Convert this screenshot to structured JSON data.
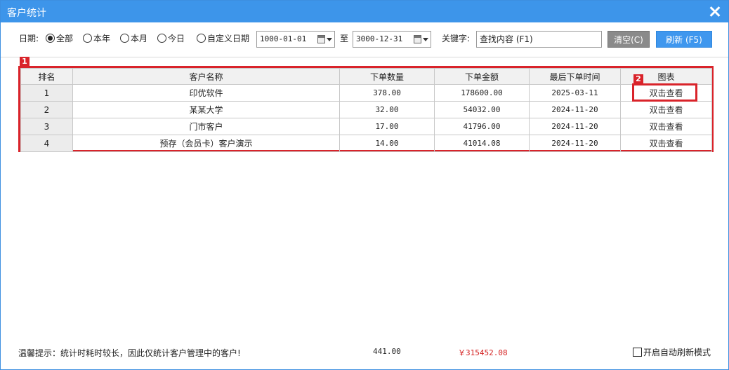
{
  "window": {
    "title": "客户统计",
    "close_icon": "close-icon"
  },
  "toolbar": {
    "date_label": "日期:",
    "radios": [
      {
        "label": "全部",
        "selected": true
      },
      {
        "label": "本年",
        "selected": false
      },
      {
        "label": "本月",
        "selected": false
      },
      {
        "label": "今日",
        "selected": false
      },
      {
        "label": "自定义日期",
        "selected": false
      }
    ],
    "start_date": "1000-01-01",
    "to_label": "至",
    "end_date": "3000-12-31",
    "keyword_label": "关键字:",
    "search_placeholder": "查找内容 (F1)",
    "clear_label": "清空(C)",
    "refresh_label": "刷新 (F5)"
  },
  "annotations": {
    "badge1": "1",
    "badge2": "2",
    "color": "#d9232a"
  },
  "table": {
    "headers": [
      "排名",
      "客户名称",
      "下单数量",
      "下单金额",
      "最后下单时间",
      "图表"
    ],
    "rows": [
      {
        "rank": "1",
        "name": "印优软件",
        "qty": "378.00",
        "amount": "178600.00",
        "last": "2025-03-11",
        "chart": "双击查看"
      },
      {
        "rank": "2",
        "name": "某某大学",
        "qty": "32.00",
        "amount": "54032.00",
        "last": "2024-11-20",
        "chart": "双击查看"
      },
      {
        "rank": "3",
        "name": "门市客户",
        "qty": "17.00",
        "amount": "41796.00",
        "last": "2024-11-20",
        "chart": "双击查看"
      },
      {
        "rank": "4",
        "name": "预存（会员卡）客户演示",
        "qty": "14.00",
        "amount": "41014.08",
        "last": "2024-11-20",
        "chart": "双击查看"
      }
    ]
  },
  "footer": {
    "tip": "温馨提示：统计时耗时较长，因此仅统计客户管理中的客户!",
    "total_qty": "441.00",
    "total_amount": "￥315452.08",
    "total_amount_color": "#d42020",
    "auto_refresh_label": "开启自动刷新模式",
    "auto_refresh_checked": false
  },
  "colors": {
    "titlebar": "#3d95ea",
    "refresh_button": "#3f97ee",
    "clear_button": "#8a8a8a"
  }
}
